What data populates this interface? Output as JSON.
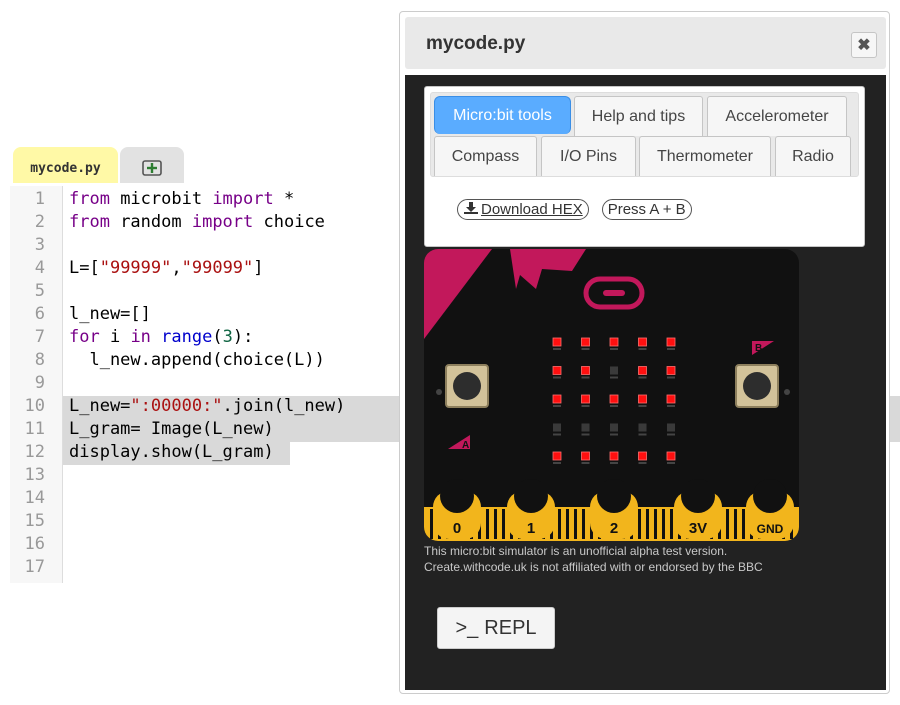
{
  "editor": {
    "active_tab": "mycode.py",
    "new_tab_icon": "add-file-icon",
    "line_numbers": [
      "1",
      "2",
      "3",
      "4",
      "5",
      "6",
      "7",
      "8",
      "9",
      "10",
      "11",
      "12",
      "13",
      "14",
      "15",
      "16",
      "17"
    ],
    "code": {
      "l1": [
        "from",
        " microbit ",
        "import",
        " *"
      ],
      "l2": [
        "from",
        " random ",
        "import",
        " choice"
      ],
      "l4": [
        "L=[",
        "\"99999\"",
        ",",
        "\"99099\"",
        "]"
      ],
      "l6": [
        "l_new=[]"
      ],
      "l7": [
        "for",
        " i ",
        "in",
        " ",
        "range",
        "(",
        "3",
        "):"
      ],
      "l8": [
        "  l_new.append(choice(L))"
      ],
      "l10": [
        "L_new=",
        "\":00000:\"",
        ".join(l_new)"
      ],
      "l11": [
        "L_gram= Image(L_new)"
      ],
      "l12": [
        "display.show(L_gram)"
      ]
    }
  },
  "dialog": {
    "title": "mycode.py",
    "close_icon": "close-icon",
    "tabs": [
      {
        "label": "Micro:bit tools",
        "active": true
      },
      {
        "label": "Help and tips",
        "active": false
      },
      {
        "label": "Accelerometer",
        "active": false
      },
      {
        "label": "Compass",
        "active": false
      },
      {
        "label": "I/O Pins",
        "active": false
      },
      {
        "label": "Thermometer",
        "active": false
      },
      {
        "label": "Radio",
        "active": false
      }
    ],
    "download_label": "Download HEX",
    "press_label": "Press A + B",
    "board": {
      "button_a": "A",
      "button_b": "B",
      "pins": [
        "0",
        "1",
        "2",
        "3V",
        "GND"
      ],
      "led_rows": [
        "99999",
        "99099",
        "99999",
        "00000",
        "99999"
      ]
    },
    "note_line1": "This micro:bit simulator is an unofficial alpha test version.",
    "note_line2": "Create.withcode.uk is not affiliated with or endorsed by the BBC",
    "repl_label": "REPL",
    "repl_prompt": ">_"
  },
  "colors": {
    "accent_tab": "#5aacff",
    "board_bg": "#111111",
    "board_accent": "#c2185b",
    "led_on": "#ff1010",
    "pin_gold": "#f2b51c"
  }
}
